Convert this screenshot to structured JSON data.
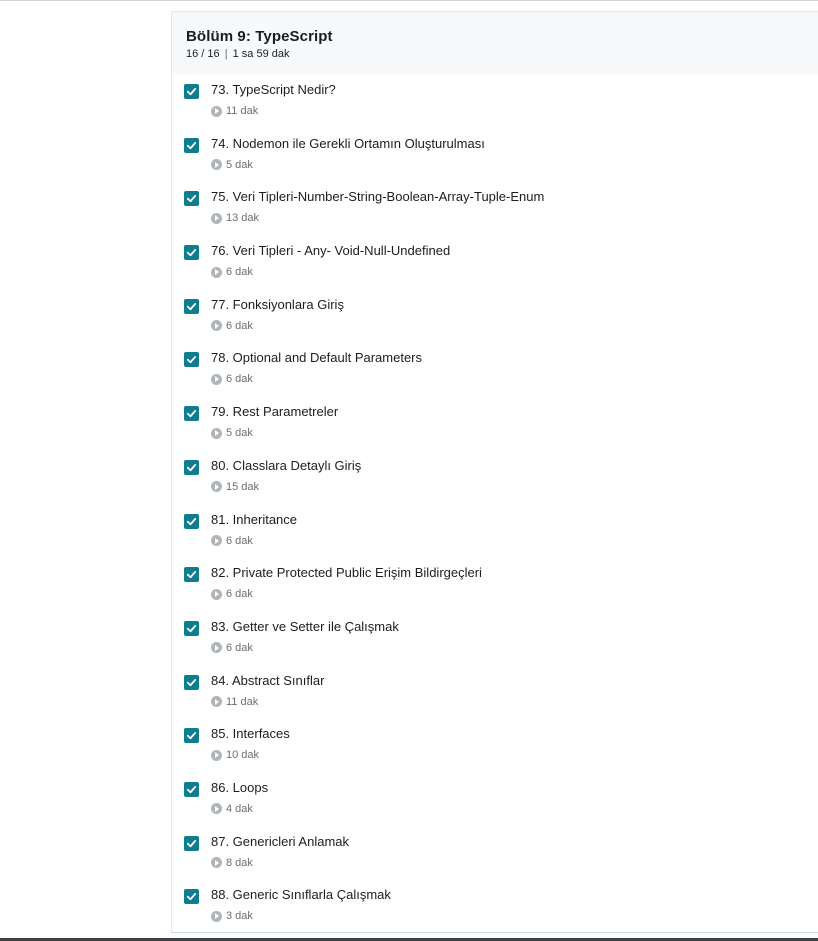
{
  "section": {
    "title": "Bölüm 9: TypeScript",
    "progress": "16 / 16",
    "separator": "|",
    "duration": "1 sa 59 dak"
  },
  "colors": {
    "checkbox": "#0f7c90",
    "header_bg": "#f7f9fa",
    "text": "#1c1d1f",
    "muted": "#6a6f73"
  },
  "items": [
    {
      "title": "73. TypeScript Nedir?",
      "duration": "11 dak",
      "completed": true
    },
    {
      "title": "74. Nodemon ile Gerekli Ortamın Oluşturulması",
      "duration": "5 dak",
      "completed": true
    },
    {
      "title": "75. Veri Tipleri-Number-String-Boolean-Array-Tuple-Enum",
      "duration": "13 dak",
      "completed": true
    },
    {
      "title": "76. Veri Tipleri - Any- Void-Null-Undefined",
      "duration": "6 dak",
      "completed": true
    },
    {
      "title": "77. Fonksiyonlara Giriş",
      "duration": "6 dak",
      "completed": true
    },
    {
      "title": "78. Optional and Default Parameters",
      "duration": "6 dak",
      "completed": true
    },
    {
      "title": "79. Rest Parametreler",
      "duration": "5 dak",
      "completed": true
    },
    {
      "title": "80. Classlara Detaylı Giriş",
      "duration": "15 dak",
      "completed": true
    },
    {
      "title": "81. Inheritance",
      "duration": "6 dak",
      "completed": true
    },
    {
      "title": "82. Private Protected Public Erişim Bildirgeçleri",
      "duration": "6 dak",
      "completed": true
    },
    {
      "title": "83. Getter ve Setter ile Çalışmak",
      "duration": "6 dak",
      "completed": true
    },
    {
      "title": "84. Abstract Sınıflar",
      "duration": "11 dak",
      "completed": true
    },
    {
      "title": "85. Interfaces",
      "duration": "10 dak",
      "completed": true
    },
    {
      "title": "86. Loops",
      "duration": "4 dak",
      "completed": true
    },
    {
      "title": "87. Genericleri Anlamak",
      "duration": "8 dak",
      "completed": true
    },
    {
      "title": "88. Generic Sınıflarla Çalışmak",
      "duration": "3 dak",
      "completed": true
    }
  ]
}
